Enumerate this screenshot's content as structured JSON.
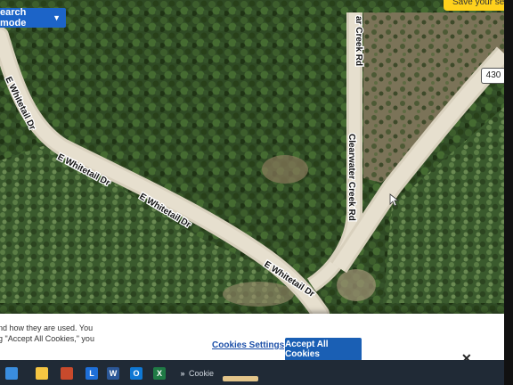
{
  "toolbar": {
    "search_mode_label": "earch mode",
    "save_search_label": "Save your searc"
  },
  "map": {
    "roads": {
      "whitetail_upper": "E Whitetail Dr",
      "whitetail_middle": "E Whitetail Dr",
      "whitetail_lower": "E Whitetail Dr",
      "whitetail_left": "E Whitetail Dr",
      "clearwater_top": "ar Creek Rd",
      "clearwater_main": "Clearwater Creek Rd"
    },
    "highway_shield": "430"
  },
  "cookie_banner": {
    "text_line1": "nd how they are used. You",
    "text_line2": "g \"Accept All Cookies,\" you",
    "settings_label": "Cookies Settings",
    "accept_label": "Accept All Cookies",
    "close_label": "✕"
  },
  "taskbar": {
    "items": [
      "windows-icon",
      "file-explorer-icon",
      "store-icon",
      "office-icon",
      "learn-icon",
      "word-icon",
      "outlook-icon",
      "excel-icon",
      "overflow-icon"
    ],
    "learn_letter": "L",
    "word_letter": "W",
    "outlook_letter": "O",
    "excel_letter": "X",
    "overflow_label": "»",
    "partial_label": "Cookie"
  }
}
